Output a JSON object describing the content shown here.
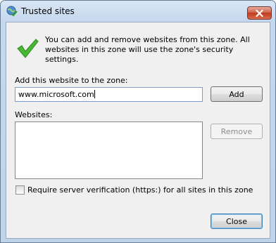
{
  "window": {
    "title": "Trusted sites",
    "title_icon": "globe-check-icon",
    "close_icon": "close-icon"
  },
  "info": {
    "icon": "green-checkmark-icon",
    "text": "You can add and remove websites from this zone. All websites in this zone will use the zone's security settings."
  },
  "add_section": {
    "label": "Add this website to the zone:",
    "value": "www.microsoft.com",
    "add_label": "Add"
  },
  "websites": {
    "label": "Websites:",
    "items": [],
    "remove_label": "Remove"
  },
  "verification": {
    "label": "Require server verification (https:) for all sites in this zone",
    "checked": false
  },
  "footer": {
    "close_label": "Close"
  },
  "colors": {
    "accent": "#3c7fb1",
    "check_green": "#3fae2a",
    "close_red": "#c1391e"
  }
}
